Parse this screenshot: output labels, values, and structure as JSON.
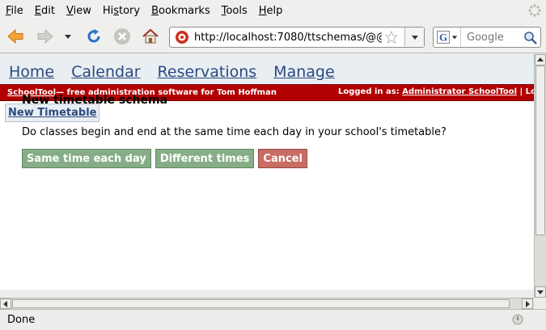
{
  "browser": {
    "menu": [
      "File",
      "Edit",
      "View",
      "History",
      "Bookmarks",
      "Tools",
      "Help"
    ],
    "menu_access_keys": [
      "F",
      "E",
      "V",
      "s",
      "B",
      "T",
      "H"
    ],
    "url": "http://localhost:7080/ttschemas/@@",
    "search_placeholder": "Google",
    "status": "Done"
  },
  "site": {
    "nav": [
      "Home",
      "Calendar",
      "Reservations",
      "Manage"
    ],
    "banner_link": "SchoolTool",
    "banner_text": " — free administration software for Tom Hoffman",
    "logged_in_label": "Logged in as: ",
    "logged_in_user": "Administrator SchoolTool",
    "logged_in_tail": " | Lo",
    "action_new_timetable": "New Timetable"
  },
  "form": {
    "title": "New timetable schema",
    "question": "Do classes begin and end at the same time each day in your school's timetable?",
    "buttons": {
      "same": "Same time each day",
      "different": "Different times",
      "cancel": "Cancel"
    }
  },
  "colors": {
    "site_nav_link": "#2b4a7f",
    "banner_bg": "#b10000",
    "button_green": "#86ad86",
    "button_red": "#c86c64"
  }
}
